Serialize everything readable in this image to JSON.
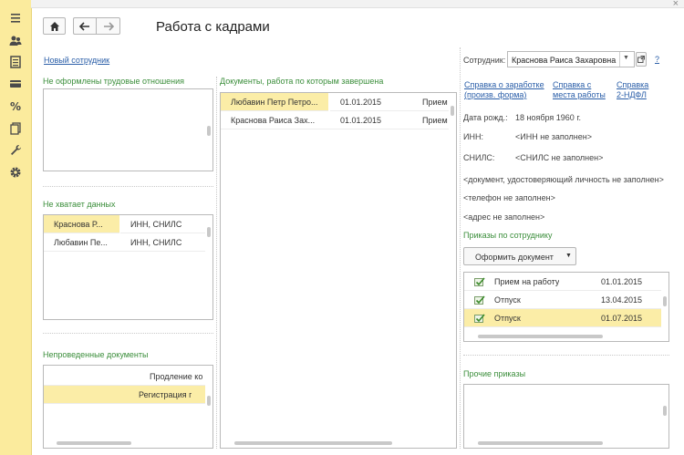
{
  "window": {
    "title": "Работа с кадрами"
  },
  "sidebar": {
    "icons": [
      "menu-icon",
      "users-icon",
      "list-icon",
      "card-icon",
      "percent-icon",
      "documents-icon",
      "wrench-icon",
      "gear-icon"
    ]
  },
  "links": {
    "new_employee": "Новый сотрудник"
  },
  "sections": {
    "no_relations": "Не оформлены трудовые отношения",
    "missing_data": "Не хватает данных",
    "unposted_docs": "Непроведенные документы",
    "completed_docs": "Документы, работа по которым завершена",
    "orders_for_employee": "Приказы по сотруднику",
    "other_orders": "Прочие приказы"
  },
  "missing_data_rows": [
    {
      "name": "Краснова Р...",
      "issue": "ИНН, СНИЛС"
    },
    {
      "name": "Любавин Пе...",
      "issue": "ИНН, СНИЛС"
    }
  ],
  "unposted_rows": [
    {
      "text": "Продление ко"
    },
    {
      "text": "Регистрация г"
    }
  ],
  "completed_rows": [
    {
      "name": "Любавин Петр Петро...",
      "date": "01.01.2015",
      "type": "Прием"
    },
    {
      "name": "Краснова Раиса Зах...",
      "date": "01.01.2015",
      "type": "Прием"
    }
  ],
  "employee": {
    "label": "Сотрудник:",
    "value": "Краснова Раиса Захаровна",
    "help": "?",
    "refs": [
      {
        "line1": "Справка о заработке",
        "line2": "(произв. форма)"
      },
      {
        "line1": "Справка с",
        "line2": "места работы"
      },
      {
        "line1": "Справка",
        "line2": "2-НДФЛ"
      }
    ],
    "birth_label": "Дата рожд.:",
    "birth_value": "18 ноября 1960 г.",
    "inn_label": "ИНН:",
    "inn_value": "<ИНН не заполнен>",
    "snils_label": "СНИЛС:",
    "snils_value": "<СНИЛС не заполнен>",
    "doc": "<документ, удостоверяющий личность не заполнен>",
    "phone": "<телефон не заполнен>",
    "address": "<адрес не заполнен>"
  },
  "orders": {
    "button": "Оформить документ",
    "rows": [
      {
        "name": "Прием на работу",
        "date": "01.01.2015"
      },
      {
        "name": "Отпуск",
        "date": "13.04.2015"
      },
      {
        "name": "Отпуск",
        "date": "01.07.2015"
      }
    ]
  },
  "colors": {
    "sidebar": "#fbeb9d",
    "selection": "#fbeda7",
    "section": "#3b8e3b",
    "link": "#2a5ea8"
  }
}
